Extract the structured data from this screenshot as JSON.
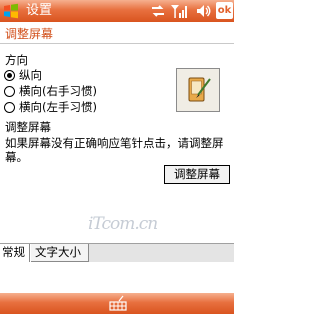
{
  "titlebar": {
    "title": "设置",
    "ok_label": "ok"
  },
  "page": {
    "title": "调整屏幕"
  },
  "orientation": {
    "section_label": "方向",
    "options": [
      {
        "label": "纵向",
        "selected": true
      },
      {
        "label": "横向(右手习惯)",
        "selected": false
      },
      {
        "label": "横向(左手习惯)",
        "selected": false
      }
    ]
  },
  "align": {
    "section_label": "调整屏幕",
    "description": "如果屏幕没有正确响应笔针点击，请调整屏幕。",
    "button_label": "调整屏幕"
  },
  "tabs": [
    {
      "label": "常规",
      "active": true
    },
    {
      "label": "文字大小",
      "active": false
    }
  ],
  "colors": {
    "accent": "#e2612c",
    "title_text": "#d2501b"
  }
}
